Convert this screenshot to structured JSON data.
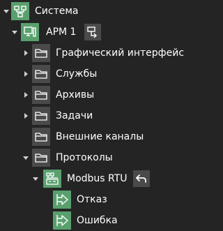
{
  "tree": {
    "root": {
      "label": "Система",
      "icon": "network-nodes-icon"
    },
    "arm": {
      "label": "АРМ 1",
      "icon": "workstation-icon",
      "action_icon": "screen-export-icon"
    },
    "items": [
      {
        "label": "Графический интерфейс",
        "icon": "folder-icon",
        "expandable": true
      },
      {
        "label": "Службы",
        "icon": "folder-icon",
        "expandable": true
      },
      {
        "label": "Архивы",
        "icon": "folder-icon",
        "expandable": true
      },
      {
        "label": "Задачи",
        "icon": "folder-icon",
        "expandable": true
      },
      {
        "label": "Внешние каналы",
        "icon": "folder-icon",
        "expandable": false
      }
    ],
    "protocols": {
      "label": "Протоколы",
      "icon": "folder-icon"
    },
    "modbus": {
      "label": "Modbus RTU",
      "icon": "modbus-device-icon",
      "action_icon": "undo-arrow-icon"
    },
    "signals": [
      {
        "label": "Отказ",
        "icon": "signal-arrow-icon"
      },
      {
        "label": "Ошибка",
        "icon": "signal-arrow-icon"
      }
    ]
  },
  "colors": {
    "background": "#242424",
    "icon_dark_bg": "#4a4a4a",
    "icon_green_bg": "#5aa06e"
  }
}
